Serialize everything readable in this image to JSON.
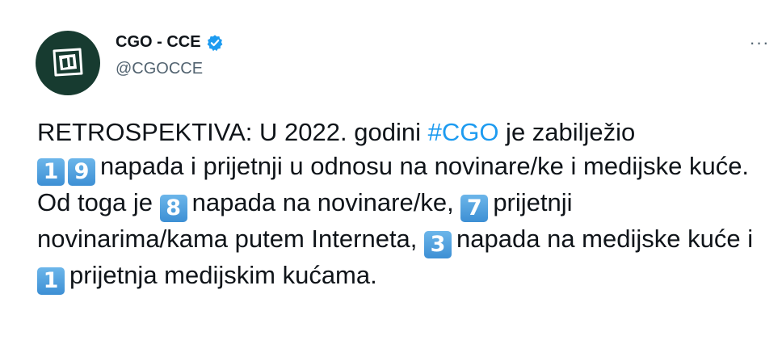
{
  "author": {
    "display_name": "CGO - CCE",
    "handle": "@CGOCCE",
    "verified": true
  },
  "more_label": "···",
  "tweet": {
    "t1": "RETROSPEKTIVA: U 2022. godini ",
    "hashtag": "#CGO",
    "t2": " je zabilježio",
    "n1": "1",
    "n2": "9",
    "t3": "napada i prijetnji u odnosu na novinare/ke i medijske kuće. Od toga je ",
    "n3": "8",
    "t4": "napada na novinare/ke, ",
    "n4": "7",
    "t5": "prijetnji novinarima/kama putem Interneta, ",
    "n5": "3",
    "t6": "napada na medijske kuće i ",
    "n6": "1",
    "t7": "prijetnja medijskim kućama."
  },
  "colors": {
    "link": "#1d9bf0",
    "avatar_bg": "#173b30",
    "text": "#0f1419",
    "secondary": "#536471"
  },
  "icons": {
    "avatar": "cgo-logo-icon",
    "verified": "verified-badge-icon",
    "more": "more-options-icon"
  }
}
